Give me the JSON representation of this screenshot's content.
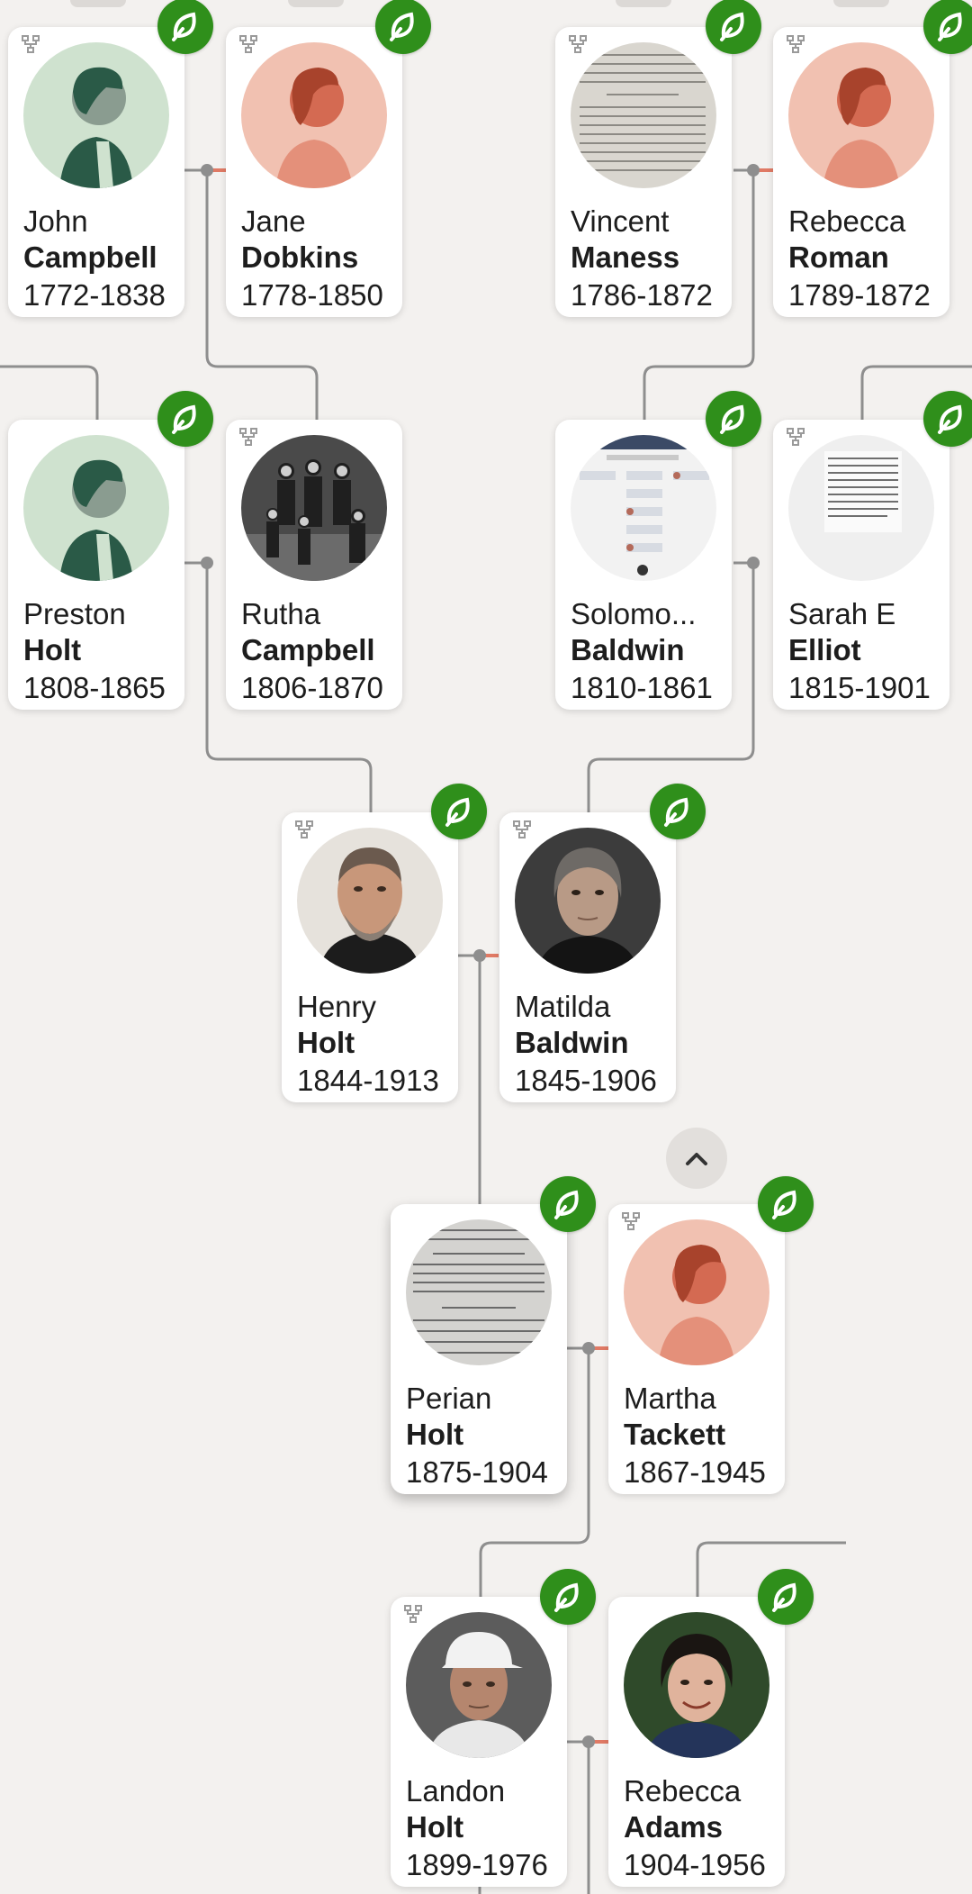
{
  "people": {
    "p1": {
      "first": "John",
      "last": "Campbell",
      "dates": "1772-1838",
      "photo": "male-silhouette"
    },
    "p2": {
      "first": "Jane",
      "last": "Dobkins",
      "dates": "1778-1850",
      "photo": "female-silhouette"
    },
    "p3": {
      "first": "Vincent",
      "last": "Maness",
      "dates": "1786-1872",
      "photo": "document-photo"
    },
    "p4": {
      "first": "Rebecca",
      "last": "Roman",
      "dates": "1789-1872",
      "photo": "female-silhouette"
    },
    "p5": {
      "first": "Preston",
      "last": "Holt",
      "dates": "1808-1865",
      "photo": "male-silhouette"
    },
    "p6": {
      "first": "Rutha",
      "last": "Campbell",
      "dates": "1806-1870",
      "photo": "family-group-photo"
    },
    "p7": {
      "first": "Solomo...",
      "last": "Baldwin",
      "dates": "1810-1861",
      "photo": "webpage-screenshot"
    },
    "p8": {
      "first": "Sarah E",
      "last": "Elliot",
      "dates": "1815-1901",
      "photo": "newspaper-clipping"
    },
    "p9": {
      "first": "Henry",
      "last": "Holt",
      "dates": "1844-1913",
      "photo": "bearded-man-portrait"
    },
    "p10": {
      "first": "Matilda",
      "last": "Baldwin",
      "dates": "1845-1906",
      "photo": "elderly-woman-portrait"
    },
    "p11": {
      "first": "Perian",
      "last": "Holt",
      "dates": "1875-1904",
      "photo": "handwritten-record"
    },
    "p12": {
      "first": "Martha",
      "last": "Tackett",
      "dates": "1867-1945",
      "photo": "female-silhouette"
    },
    "p13": {
      "first": "Landon",
      "last": "Holt",
      "dates": "1899-1976",
      "photo": "man-white-cap-portrait"
    },
    "p14": {
      "first": "Rebecca",
      "last": "Adams",
      "dates": "1904-1956",
      "photo": "smiling-woman-portrait"
    }
  },
  "icons": {
    "hint": "leaf-hint-icon",
    "tree": "family-tree-icon",
    "collapse": "chevron-up-icon"
  },
  "colors": {
    "hint_green": "#2f8f1b",
    "male_bg": "#cfe2cf",
    "male_fg": "#2a5a47",
    "female_bg": "#f1c1b1",
    "female_fg": "#c0573e",
    "line_grey": "#8e8e8e",
    "spouse_red": "#e07a65"
  }
}
